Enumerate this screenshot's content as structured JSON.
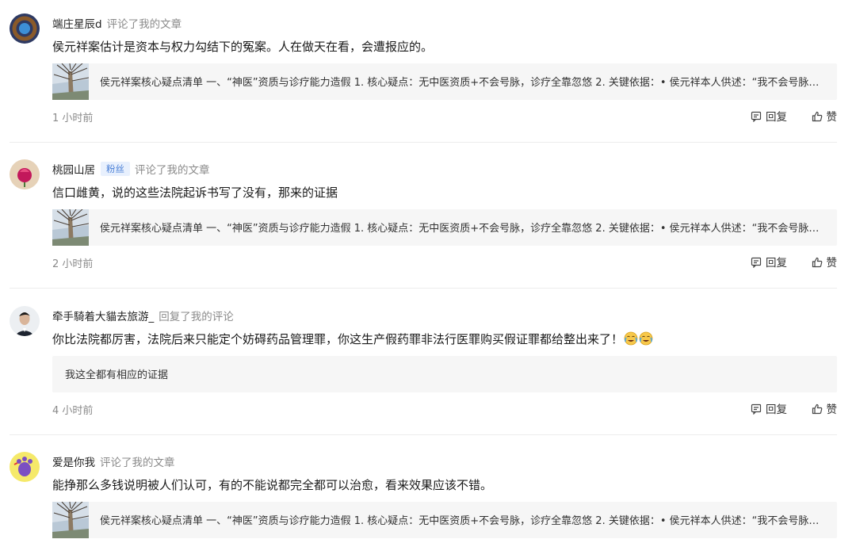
{
  "colors": {
    "accent_blue": "#4a7fd6",
    "fan_badge_bg": "#e8f0fd",
    "card_bg": "#f6f6f6",
    "muted": "#8a8a8a"
  },
  "notifications": [
    {
      "name": "端庄星辰d",
      "action": "评论了我的文章",
      "comment": "侯元祥案估计是资本与权力勾结下的冤案。人在做天在看，会遭报应的。",
      "card_text": "侯元祥案核心疑点清单 一、“神医”资质与诊疗能力造假 1. 核心疑点：无中医资质+不会号脉，诊疗全靠忽悠 2. 关键依据：• 侯元祥本人供述：“我不会号脉，也不懂中医”…",
      "time": "1 小时前",
      "reply_label": "回复",
      "like_label": "赞"
    },
    {
      "name": "桃园山居",
      "badge": "粉丝",
      "action": "评论了我的文章",
      "comment": "信口雌黄，说的这些法院起诉书写了没有，那来的证据",
      "card_text": "侯元祥案核心疑点清单 一、“神医”资质与诊疗能力造假 1. 核心疑点：无中医资质+不会号脉，诊疗全靠忽悠 2. 关键依据：• 侯元祥本人供述：“我不会号脉，也不懂中医”…",
      "time": "2 小时前",
      "reply_label": "回复",
      "like_label": "赞"
    },
    {
      "name": "牵手騎着大貓去旅游_",
      "action": "回复了我的评论",
      "comment": "你比法院都厉害，法院后来只能定个妨碍药品管理罪，你这生产假药罪非法行医罪购买假证罪都给整出来了！",
      "card_text": "我这全都有相应的证据",
      "time": "4 小时前",
      "reply_label": "回复",
      "like_label": "赞"
    },
    {
      "name": "爱是你我",
      "action": "评论了我的文章",
      "comment": "能挣那么多钱说明被人们认可，有的不能说都完全都可以治愈，看来效果应该不错。",
      "card_text": "侯元祥案核心疑点清单 一、“神医”资质与诊疗能力造假 1. 核心疑点：无中医资质+不会号脉，诊疗全靠忽悠 2. 关键依据：• 侯元祥本人供述：“我不会号脉，也不懂中医”…"
    }
  ]
}
